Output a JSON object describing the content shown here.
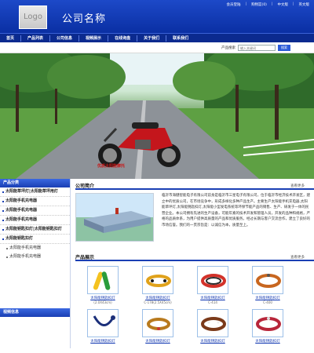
{
  "header": {
    "logo_text": "Logo",
    "company_name": "公司名称",
    "top_links": [
      "会员登陆",
      "购物篮(0)",
      "中文版",
      "英文版",
      "网站导航"
    ]
  },
  "nav": {
    "items": [
      "首页",
      "产品列表",
      "公司信息",
      "视频展示",
      "在线询盘",
      "关于我们",
      "联系我们"
    ]
  },
  "search": {
    "label": "产品搜索",
    "placeholder": "输入关键词",
    "button_label": "搜索"
  },
  "banner": {
    "tag": "优质太阳能摩托"
  },
  "sidebar": {
    "category_title": "产品分类",
    "categories": [
      {
        "label": "太阳能草坪灯|太阳能草坪用灯",
        "type": "item"
      },
      {
        "label": "太阳能手机充电器",
        "type": "item"
      },
      {
        "label": "太阳能手机充电器",
        "type": "item"
      },
      {
        "label": "太阳能手机充电器",
        "type": "item"
      },
      {
        "label": "太阳能钥匙扣灯|太阳能钥匙扣灯",
        "type": "item"
      },
      {
        "label": "太阳能钥匙扣灯",
        "type": "item"
      },
      {
        "label": "太阳能手机充电器",
        "type": "sub"
      },
      {
        "label": "太阳能手机充电器",
        "type": "sub"
      }
    ],
    "video_title": "视频信息"
  },
  "main": {
    "intro_title": "公司简介",
    "intro_more": "查看更多",
    "intro_text": "临沂市海健智能电子有限公司前身是临沂市三星电子有限公司，位于临沂市经济技术开发区，建立中的优质公司，在市场竞争中，形成多样化多种产品生产。主要生产太阳能手机充电器,太阳能草坪灯,太阳能钥匙扣灯,太阳能小型发电系统等环保节能产品的销售、生产、研发于一体的民营企业。本公司拥有先进的生产设备，可能年素的技术开发和管理人员，开发的品种和规格，严格的品质体系，为用户提供高质量的产品和优质服务。经过长期与客户交流合作，建立了良好的市场信誉。我们的一贯宗旨是：以诚信为本，质量至上。",
    "products_title": "产品展示",
    "products_more": "查看更多",
    "products": [
      {
        "name": "太阳能钥匙扣灯",
        "code": "(2.0X43cm)"
      },
      {
        "name": "太阳能钥匙扣灯",
        "code": "C-178(2.5X45cm)"
      },
      {
        "name": "太阳能钥匙扣灯",
        "code": "C-414"
      },
      {
        "name": "太阳能钥匙扣灯",
        "code": "C-400"
      },
      {
        "name": "太阳能钥匙扣灯",
        "code": ""
      },
      {
        "name": "太阳能钥匙扣灯",
        "code": ""
      },
      {
        "name": "太阳能钥匙扣灯",
        "code": ""
      },
      {
        "name": "太阳能钥匙扣灯",
        "code": ""
      }
    ]
  },
  "colors": {
    "brand_blue": "#1a3fb4",
    "nav_blue": "#0b2a8f",
    "accent_red": "#c81616"
  }
}
